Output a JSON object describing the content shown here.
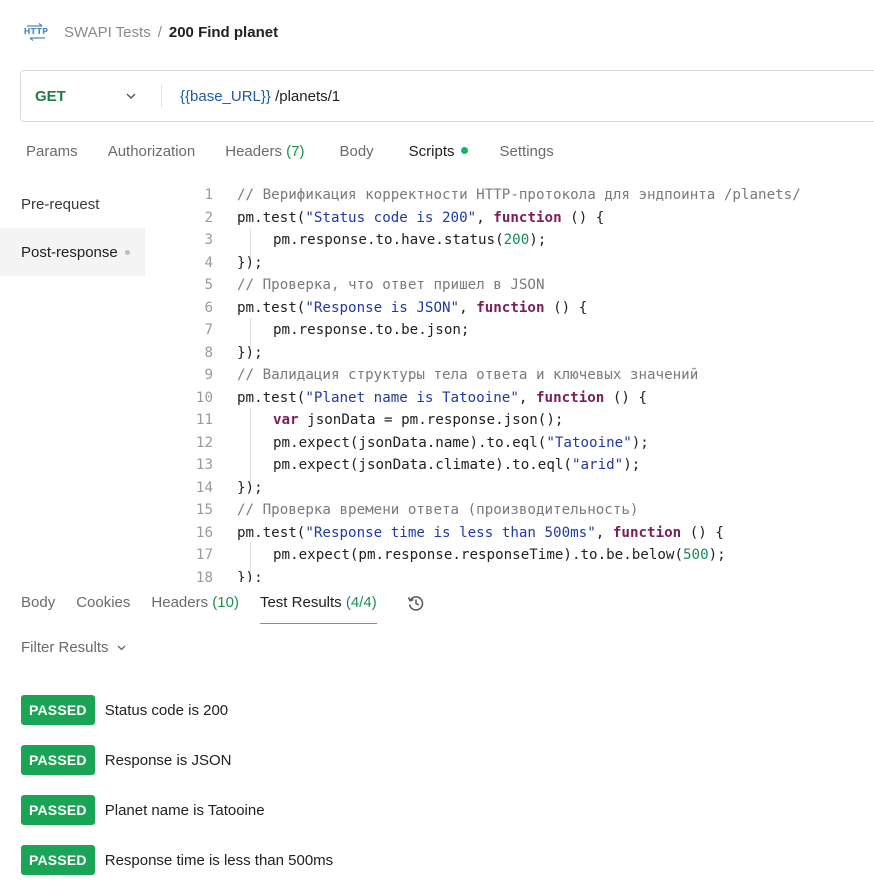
{
  "breadcrumb": {
    "icon_text": "HTTP",
    "parent": "SWAPI Tests",
    "separator": "/",
    "current": "200 Find planet"
  },
  "request": {
    "method": "GET",
    "url_variable": "{{base_URL}}",
    "url_path": " /planets/1"
  },
  "request_tabs": [
    {
      "label": "Params"
    },
    {
      "label": "Authorization"
    },
    {
      "label": "Headers",
      "count": "(7)"
    },
    {
      "label": "Body"
    },
    {
      "label": "Scripts"
    },
    {
      "label": "Settings"
    }
  ],
  "script_nav": {
    "pre_request": "Pre-request",
    "post_response": "Post-response"
  },
  "code_lines": [
    {
      "n": "1",
      "indent": false,
      "tokens": [
        [
          "cmt",
          "// Верификация корректности HTTP-протокола для эндпоинта /planets/"
        ]
      ]
    },
    {
      "n": "2",
      "indent": false,
      "tokens": [
        [
          "",
          "pm.test("
        ],
        [
          "str",
          "\"Status code is 200\""
        ],
        [
          "",
          ", "
        ],
        [
          "kw",
          "function"
        ],
        [
          "",
          " () {"
        ]
      ]
    },
    {
      "n": "3",
      "indent": true,
      "tokens": [
        [
          "",
          "pm.response.to.have.status("
        ],
        [
          "num",
          "200"
        ],
        [
          "",
          ");"
        ]
      ]
    },
    {
      "n": "4",
      "indent": false,
      "tokens": [
        [
          "",
          "});"
        ]
      ]
    },
    {
      "n": "5",
      "indent": false,
      "tokens": [
        [
          "cmt",
          "// Проверка, что ответ пришел в JSON"
        ]
      ]
    },
    {
      "n": "6",
      "indent": false,
      "tokens": [
        [
          "",
          "pm.test("
        ],
        [
          "str",
          "\"Response is JSON\""
        ],
        [
          "",
          ", "
        ],
        [
          "kw",
          "function"
        ],
        [
          "",
          " () {"
        ]
      ]
    },
    {
      "n": "7",
      "indent": true,
      "tokens": [
        [
          "",
          "pm.response.to.be.json;"
        ]
      ]
    },
    {
      "n": "8",
      "indent": false,
      "tokens": [
        [
          "",
          "});"
        ]
      ]
    },
    {
      "n": "9",
      "indent": false,
      "tokens": [
        [
          "cmt",
          "// Валидация структуры тела ответа и ключевых значений"
        ]
      ]
    },
    {
      "n": "10",
      "indent": false,
      "tokens": [
        [
          "",
          "pm.test("
        ],
        [
          "str",
          "\"Planet name is Tatooine\""
        ],
        [
          "",
          ", "
        ],
        [
          "kw",
          "function"
        ],
        [
          "",
          " () {"
        ]
      ]
    },
    {
      "n": "11",
      "indent": true,
      "tokens": [
        [
          "kw",
          "var"
        ],
        [
          "",
          " jsonData = pm.response.json();"
        ]
      ]
    },
    {
      "n": "12",
      "indent": true,
      "tokens": [
        [
          "",
          "pm.expect(jsonData.name).to.eql("
        ],
        [
          "str",
          "\"Tatooine\""
        ],
        [
          "",
          ");"
        ]
      ]
    },
    {
      "n": "13",
      "indent": true,
      "tokens": [
        [
          "",
          "pm.expect(jsonData.climate).to.eql("
        ],
        [
          "str",
          "\"arid\""
        ],
        [
          "",
          ");"
        ]
      ]
    },
    {
      "n": "14",
      "indent": false,
      "tokens": [
        [
          "",
          "});"
        ]
      ]
    },
    {
      "n": "15",
      "indent": false,
      "tokens": [
        [
          "cmt",
          "// Проверка времени ответа (производительность)"
        ]
      ]
    },
    {
      "n": "16",
      "indent": false,
      "tokens": [
        [
          "",
          "pm.test("
        ],
        [
          "str",
          "\"Response time is less than 500ms\""
        ],
        [
          "",
          ", "
        ],
        [
          "kw",
          "function"
        ],
        [
          "",
          " () {"
        ]
      ]
    },
    {
      "n": "17",
      "indent": true,
      "tokens": [
        [
          "",
          "pm.expect(pm.response.responseTime).to.be.below("
        ],
        [
          "num",
          "500"
        ],
        [
          "",
          ");"
        ]
      ]
    },
    {
      "n": "18",
      "indent": false,
      "tokens": [
        [
          "",
          "});"
        ]
      ]
    }
  ],
  "response_tabs": [
    {
      "label": "Body"
    },
    {
      "label": "Cookies"
    },
    {
      "label": "Headers",
      "count": "(10)"
    },
    {
      "label": "Test Results",
      "count": "(4/4)"
    }
  ],
  "filter_label": "Filter Results",
  "test_results": [
    {
      "status": "PASSED",
      "name": "Status code is 200"
    },
    {
      "status": "PASSED",
      "name": "Response is JSON"
    },
    {
      "status": "PASSED",
      "name": "Planet name is Tatooine"
    },
    {
      "status": "PASSED",
      "name": "Response time is less than 500ms"
    }
  ],
  "colors": {
    "passed_badge": "#1aa556",
    "method_get": "#1d7f45",
    "active_tab_underline": "#e96a3a",
    "scripts_indicator": "#16b364"
  }
}
